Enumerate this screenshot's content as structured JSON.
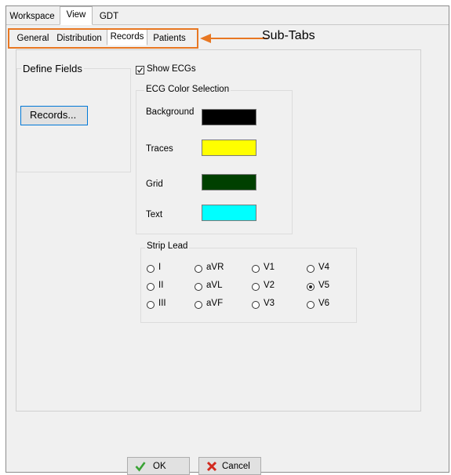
{
  "main_tabs": [
    "Workspace",
    "View",
    "GDT"
  ],
  "sub_tabs": [
    "General",
    "Distribution",
    "Records",
    "Patients"
  ],
  "annotation": {
    "label": "Sub-Tabs",
    "highlight_color": "#e87722"
  },
  "define_fields": {
    "title": "Define Fields",
    "button_label": "Records..."
  },
  "show_ecgs": {
    "label": "Show ECGs",
    "checked": true
  },
  "ecg_colors": {
    "title": "ECG Color Selection",
    "items": [
      {
        "label": "Background",
        "color": "#000000"
      },
      {
        "label": "Traces",
        "color": "#ffff00"
      },
      {
        "label": "Grid",
        "color": "#004000"
      },
      {
        "label": "Text",
        "color": "#00ffff"
      }
    ]
  },
  "strip_lead": {
    "title": "Strip Lead",
    "options": [
      {
        "label": "I",
        "selected": false
      },
      {
        "label": "aVR",
        "selected": false
      },
      {
        "label": "V1",
        "selected": false
      },
      {
        "label": "V4",
        "selected": false
      },
      {
        "label": "II",
        "selected": false
      },
      {
        "label": "aVL",
        "selected": false
      },
      {
        "label": "V2",
        "selected": false
      },
      {
        "label": "V5",
        "selected": true
      },
      {
        "label": "III",
        "selected": false
      },
      {
        "label": "aVF",
        "selected": false
      },
      {
        "label": "V3",
        "selected": false
      },
      {
        "label": "V6",
        "selected": false
      }
    ]
  },
  "footer": {
    "ok_label": "OK",
    "cancel_label": "Cancel"
  }
}
